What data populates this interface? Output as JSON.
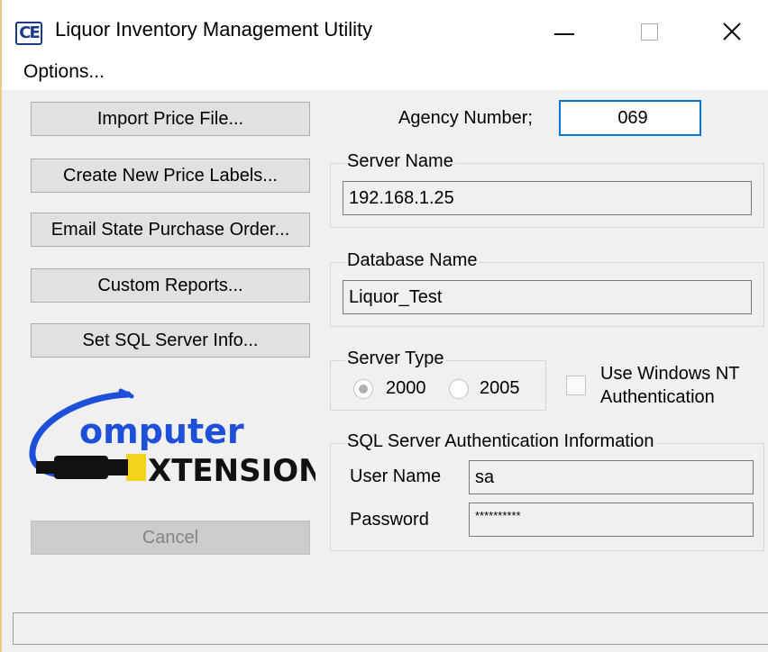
{
  "window": {
    "title": "Liquor Inventory Management Utility",
    "icon": "ce-app-icon"
  },
  "menu": {
    "options": "Options..."
  },
  "buttons": {
    "import": "Import Price File...",
    "create_labels": "Create New Price Labels...",
    "email_order": "Email State Purchase Order...",
    "custom_reports": "Custom Reports...",
    "set_sql": "Set SQL Server Info...",
    "cancel": "Cancel"
  },
  "agency": {
    "label": "Agency Number;",
    "value": "069"
  },
  "server": {
    "group_title": "Server Name",
    "value": "192.168.1.25"
  },
  "database": {
    "group_title": "Database Name",
    "value": "Liquor_Test"
  },
  "server_type": {
    "group_title": "Server Type",
    "options": [
      "2000",
      "2005"
    ],
    "selected": "2000"
  },
  "nt_auth": {
    "label_line1": "Use Windows NT",
    "label_line2": "Authentication",
    "checked": false
  },
  "sql_auth": {
    "group_title": "SQL Server Authentication Information",
    "user_label": "User Name",
    "user_value": "sa",
    "password_label": "Password",
    "password_value": "**********"
  },
  "logo": {
    "line1": "omputer",
    "line2": "XTENSIONS"
  },
  "colors": {
    "window_bg": "#f0f0f0",
    "accent_blue": "#0078d7",
    "logo_blue": "#1e4fd8",
    "logo_yellow": "#f2d21a"
  }
}
